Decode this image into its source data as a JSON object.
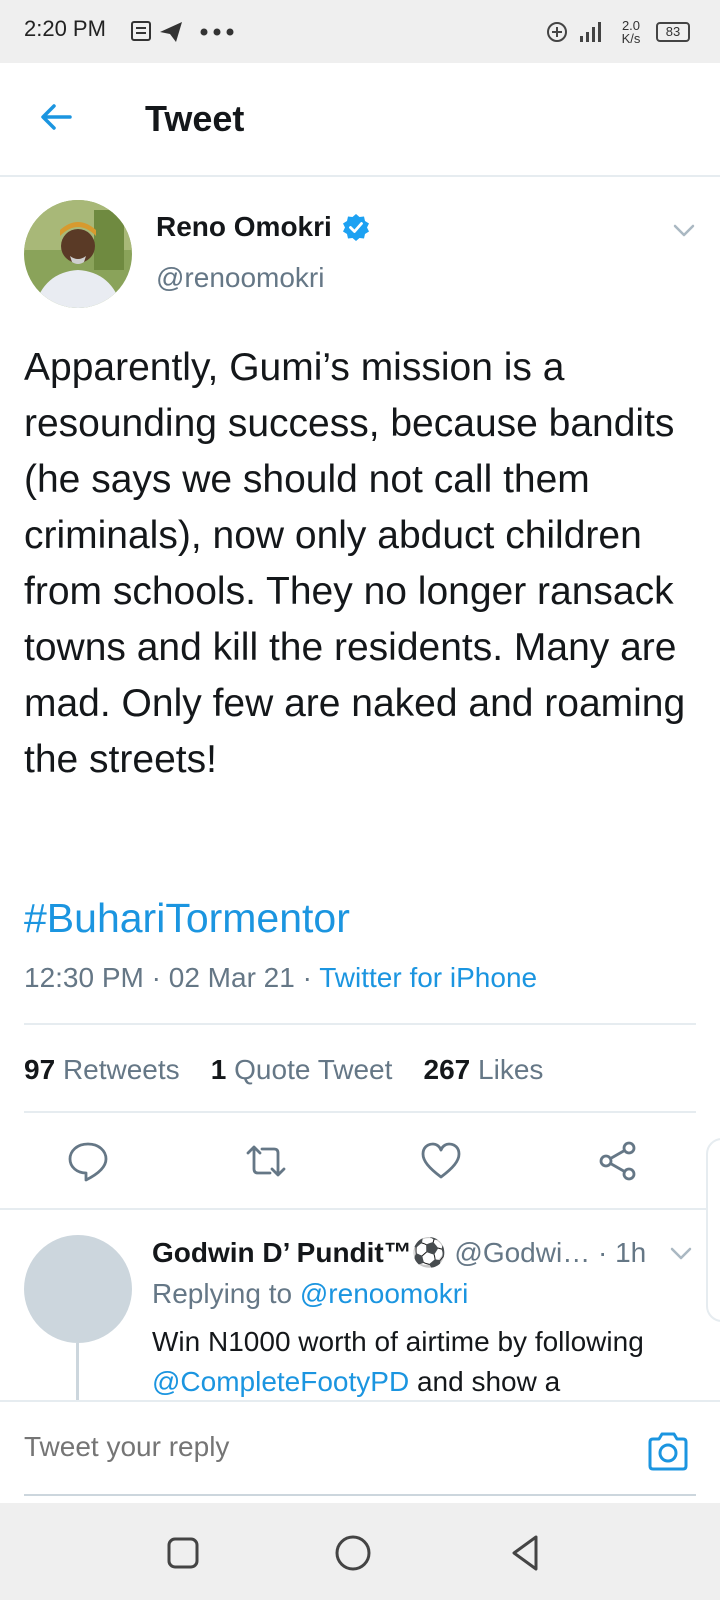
{
  "status_bar": {
    "time": "2:20 PM",
    "net_speed": "2.0 K/s",
    "battery": "83"
  },
  "header": {
    "title": "Tweet"
  },
  "tweet": {
    "author_name": "Reno Omokri",
    "author_handle": "@renoomokri",
    "text": "Apparently, Gumi’s mission is a resounding success, because bandits (he says we should not call them criminals), now only abduct children from schools. They no longer ransack towns and kill the residents. Many are mad. Only few are naked and roaming the streets!",
    "hashtag": "#BuhariTormentor",
    "time": "12:30 PM",
    "date": "02 Mar 21",
    "source": "Twitter for iPhone",
    "stats": {
      "retweets_count": "97",
      "retweets_label": "Retweets",
      "quotes_count": "1",
      "quotes_label": "Quote Tweet",
      "likes_count": "267",
      "likes_label": "Likes"
    }
  },
  "reply": {
    "name": "Godwin D’ Pundit™⚽",
    "handle": "@Godwi…",
    "age": "· 1h",
    "replying_prefix": "Replying to",
    "replying_to": "@renoomokri",
    "text_1": "Win N1000 worth of airtime by following",
    "mention": "@CompleteFootyPD",
    "text_2": "and show a"
  },
  "composer": {
    "placeholder": "Tweet your reply"
  },
  "colors": {
    "accent": "#1b95e0",
    "text": "#14171a",
    "secondary": "#657786",
    "divider": "#e6ecf0"
  },
  "icons": [
    "back-arrow-icon",
    "verified-badge-icon",
    "chevron-down-icon",
    "reply-icon",
    "retweet-icon",
    "like-icon",
    "share-icon",
    "camera-icon",
    "nav-recents-icon",
    "nav-home-icon",
    "nav-back-icon"
  ]
}
